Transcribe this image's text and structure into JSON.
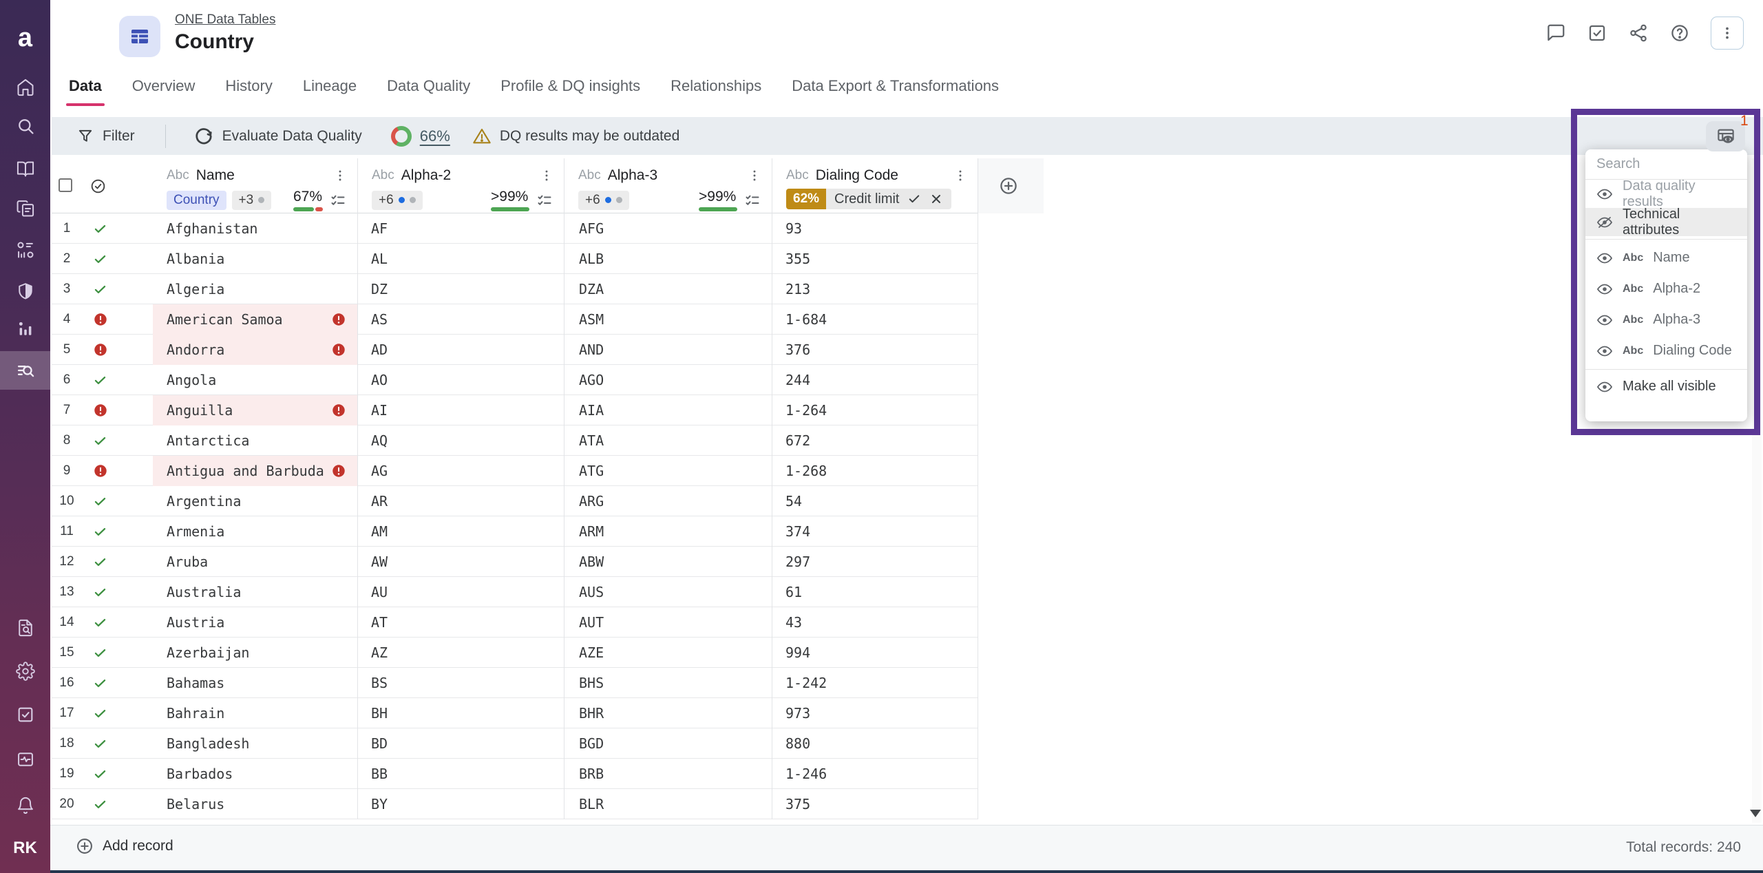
{
  "app": {
    "logo": "a",
    "avatar": "RK"
  },
  "sidebar": {
    "items": [
      "home",
      "search",
      "knowledge-catalog",
      "documents",
      "data-structures",
      "governance-shield",
      "insights",
      "data-exploration",
      "audit",
      "settings",
      "tasks",
      "monitoring",
      "notifications"
    ],
    "active": "data-exploration"
  },
  "header": {
    "breadcrumb": "ONE Data Tables",
    "title": "Country",
    "actions": [
      "comments",
      "tasks",
      "share",
      "help",
      "more"
    ]
  },
  "tabs": [
    {
      "label": "Data",
      "active": true
    },
    {
      "label": "Overview",
      "active": false
    },
    {
      "label": "History",
      "active": false
    },
    {
      "label": "Lineage",
      "active": false
    },
    {
      "label": "Data Quality",
      "active": false
    },
    {
      "label": "Profile & DQ insights",
      "active": false
    },
    {
      "label": "Relationships",
      "active": false
    },
    {
      "label": "Data Export & Transformations",
      "active": false
    }
  ],
  "toolbar": {
    "filter_label": "Filter",
    "evaluate_label": "Evaluate Data Quality",
    "dq_score": "66%",
    "dq_warning": "DQ results may be outdated"
  },
  "grid": {
    "abc": "Abc",
    "columns": [
      {
        "label": "Name",
        "tag": "Country",
        "overflow": "+3",
        "quality": "67%"
      },
      {
        "label": "Alpha-2",
        "overflow": "+6",
        "quality": ">99%"
      },
      {
        "label": "Alpha-3",
        "overflow": "+6",
        "quality": ">99%"
      },
      {
        "label": "Dialing Code",
        "quality": "62%",
        "rule_label": "Credit limit"
      }
    ],
    "rows": [
      {
        "n": 1,
        "name": "Afghanistan",
        "alpha2": "AF",
        "alpha3": "AFG",
        "dialing": "93",
        "error": false
      },
      {
        "n": 2,
        "name": "Albania",
        "alpha2": "AL",
        "alpha3": "ALB",
        "dialing": "355",
        "error": false
      },
      {
        "n": 3,
        "name": "Algeria",
        "alpha2": "DZ",
        "alpha3": "DZA",
        "dialing": "213",
        "error": false
      },
      {
        "n": 4,
        "name": "American Samoa",
        "alpha2": "AS",
        "alpha3": "ASM",
        "dialing": "1-684",
        "error": true
      },
      {
        "n": 5,
        "name": "Andorra",
        "alpha2": "AD",
        "alpha3": "AND",
        "dialing": "376",
        "error": true
      },
      {
        "n": 6,
        "name": "Angola",
        "alpha2": "AO",
        "alpha3": "AGO",
        "dialing": "244",
        "error": false
      },
      {
        "n": 7,
        "name": "Anguilla",
        "alpha2": "AI",
        "alpha3": "AIA",
        "dialing": "1-264",
        "error": true
      },
      {
        "n": 8,
        "name": "Antarctica",
        "alpha2": "AQ",
        "alpha3": "ATA",
        "dialing": "672",
        "error": false
      },
      {
        "n": 9,
        "name": "Antigua and Barbuda",
        "alpha2": "AG",
        "alpha3": "ATG",
        "dialing": "1-268",
        "error": true
      },
      {
        "n": 10,
        "name": "Argentina",
        "alpha2": "AR",
        "alpha3": "ARG",
        "dialing": "54",
        "error": false
      },
      {
        "n": 11,
        "name": "Armenia",
        "alpha2": "AM",
        "alpha3": "ARM",
        "dialing": "374",
        "error": false
      },
      {
        "n": 12,
        "name": "Aruba",
        "alpha2": "AW",
        "alpha3": "ABW",
        "dialing": "297",
        "error": false
      },
      {
        "n": 13,
        "name": "Australia",
        "alpha2": "AU",
        "alpha3": "AUS",
        "dialing": "61",
        "error": false
      },
      {
        "n": 14,
        "name": "Austria",
        "alpha2": "AT",
        "alpha3": "AUT",
        "dialing": "43",
        "error": false
      },
      {
        "n": 15,
        "name": "Azerbaijan",
        "alpha2": "AZ",
        "alpha3": "AZE",
        "dialing": "994",
        "error": false
      },
      {
        "n": 16,
        "name": "Bahamas",
        "alpha2": "BS",
        "alpha3": "BHS",
        "dialing": "1-242",
        "error": false
      },
      {
        "n": 17,
        "name": "Bahrain",
        "alpha2": "BH",
        "alpha3": "BHR",
        "dialing": "973",
        "error": false
      },
      {
        "n": 18,
        "name": "Bangladesh",
        "alpha2": "BD",
        "alpha3": "BGD",
        "dialing": "880",
        "error": false
      },
      {
        "n": 19,
        "name": "Barbados",
        "alpha2": "BB",
        "alpha3": "BRB",
        "dialing": "1-246",
        "error": false
      },
      {
        "n": 20,
        "name": "Belarus",
        "alpha2": "BY",
        "alpha3": "BLR",
        "dialing": "375",
        "error": false
      }
    ]
  },
  "panel": {
    "badge": "1",
    "search_placeholder": "Search",
    "abc": "Abc",
    "items": {
      "dq": "Data quality results",
      "tech": "Technical attributes"
    },
    "attributes": [
      "Name",
      "Alpha-2",
      "Alpha-3",
      "Dialing Code"
    ],
    "make_all": "Make all visible"
  },
  "footer": {
    "add_record": "Add record",
    "total": "Total records: 240"
  },
  "colors": {
    "accent_purple": "#5b3795",
    "tab_underline": "#d6336c",
    "dq_green": "#5fb264",
    "dq_red": "#d9544a",
    "amber": "#bf8b16",
    "error_bg": "#fbecec",
    "error_red": "#c2342c"
  }
}
